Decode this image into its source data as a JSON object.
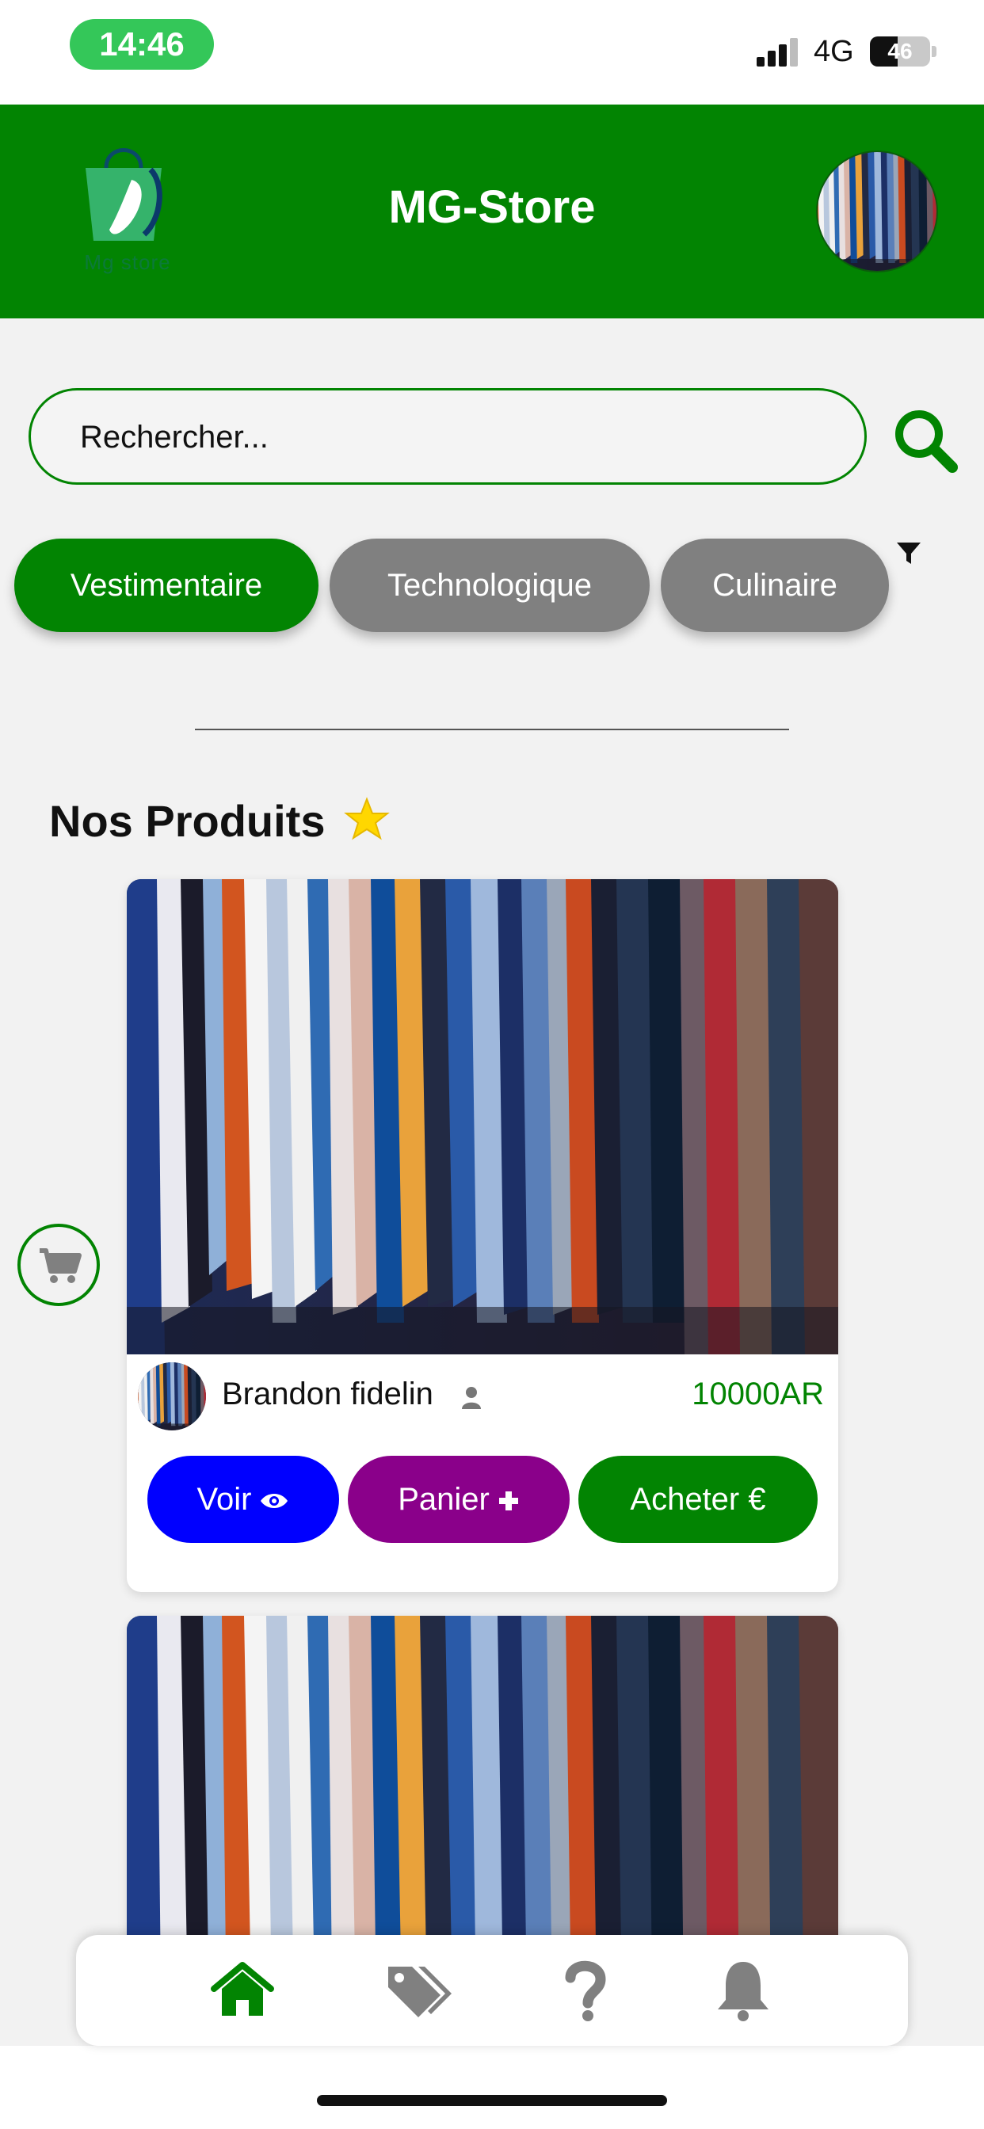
{
  "status_bar": {
    "time": "14:46",
    "network": "4G",
    "battery": "46",
    "battery_level": 0.46,
    "signal_bars": 3
  },
  "header": {
    "logo_text": "Mg store",
    "title": "MG-Store"
  },
  "search": {
    "placeholder": "Rechercher..."
  },
  "categories": [
    {
      "label": "Vestimentaire",
      "active": true
    },
    {
      "label": "Technologique",
      "active": false
    },
    {
      "label": "Culinaire",
      "active": false
    }
  ],
  "section": {
    "title": "Nos Produits"
  },
  "products": [
    {
      "seller": "Brandon fidelin",
      "price": "10000AR",
      "buttons": {
        "view": "Voir",
        "cart": "Panier",
        "buy": "Acheter €"
      }
    },
    {
      "seller": "",
      "price": "",
      "buttons": {}
    }
  ],
  "colors": {
    "primary_green": "#028402",
    "view_blue": "#0000ff",
    "cart_purple": "#8a008a",
    "inactive_gray": "#808080",
    "star_yellow": "#ffd700"
  },
  "icons": {
    "search": "search-icon",
    "filter": "filter-icon",
    "star": "star-icon",
    "eye": "eye-icon",
    "plus": "plus-icon",
    "cart": "shopping-cart-icon",
    "user": "user-icon",
    "home": "home-icon",
    "tags": "tags-icon",
    "help": "question-icon",
    "bell": "bell-icon"
  }
}
